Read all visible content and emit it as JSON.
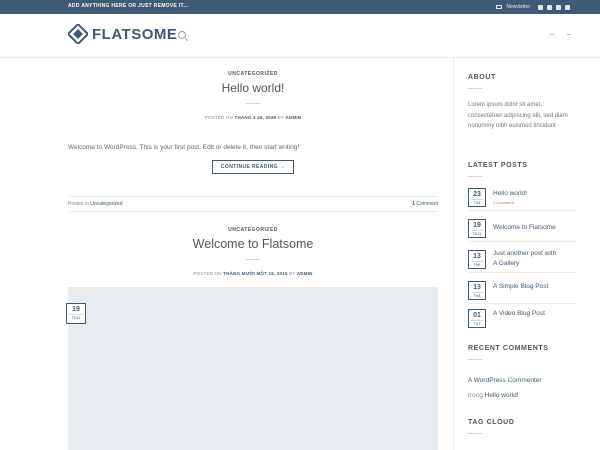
{
  "topbar": {
    "message": "ADD ANYTHING HERE OR JUST REMOVE IT...",
    "newsletter": "Newsletter",
    "social": [
      "facebook-icon",
      "instagram-icon",
      "twitter-icon",
      "email-icon"
    ]
  },
  "header": {
    "logo_text": "FLATSOME"
  },
  "posts": [
    {
      "category": "UNCATEGORIZED",
      "title": "Hello world!",
      "meta_prefix": "POSTED ON ",
      "meta_date": "THÁNG 4 25, 2026",
      "meta_by": " BY ",
      "meta_author": "ADMIN",
      "excerpt": "Welcome to WordPress. This is your first post. Edit or delete it, then start writing!",
      "button": "CONTINUE READING →",
      "posted_in_label": "Posted in ",
      "posted_in": "Uncategorized",
      "comments_count": "1",
      "comments_label": " Comment"
    },
    {
      "category": "UNCATEGORIZED",
      "title": "Welcome to Flatsome",
      "meta_prefix": "POSTED ON ",
      "meta_date": "THÁNG MƯỜI MỘT 19, 2015",
      "meta_by": " BY ",
      "meta_author": "ADMIN",
      "badge_day": "19",
      "badge_month": "Th11"
    }
  ],
  "sidebar": {
    "about_title": "ABOUT",
    "about_text": "Lorem ipsum dolor sit amet, consectetuer adipiscing elit, sed diam nonummy nibh euismod tincidunt",
    "latest_title": "LATEST POSTS",
    "latest": [
      {
        "day": "23",
        "month": "Th4",
        "title": "Hello world!",
        "sub": "1 Comment"
      },
      {
        "day": "19",
        "month": "Th11",
        "title": "Welcome to Flatsome",
        "sub": ""
      },
      {
        "day": "13",
        "month": "Th8",
        "title": "Just another post with",
        "title2": "A Gallery",
        "sub": ""
      },
      {
        "day": "13",
        "month": "Th8",
        "title": "A Simple Blog Post",
        "sub": ""
      },
      {
        "day": "01",
        "month": "Th7",
        "title": "A Video Blog Post",
        "sub": ""
      }
    ],
    "comments_title": "RECENT COMMENTS",
    "comment_author": "A WordPress Commenter",
    "comment_on": "trong ",
    "comment_post": "Hello world!",
    "tags_title": "TAG CLOUD"
  },
  "colors": {
    "accent": "#3e5a74",
    "image_placeholder": "#e7ecf1"
  }
}
